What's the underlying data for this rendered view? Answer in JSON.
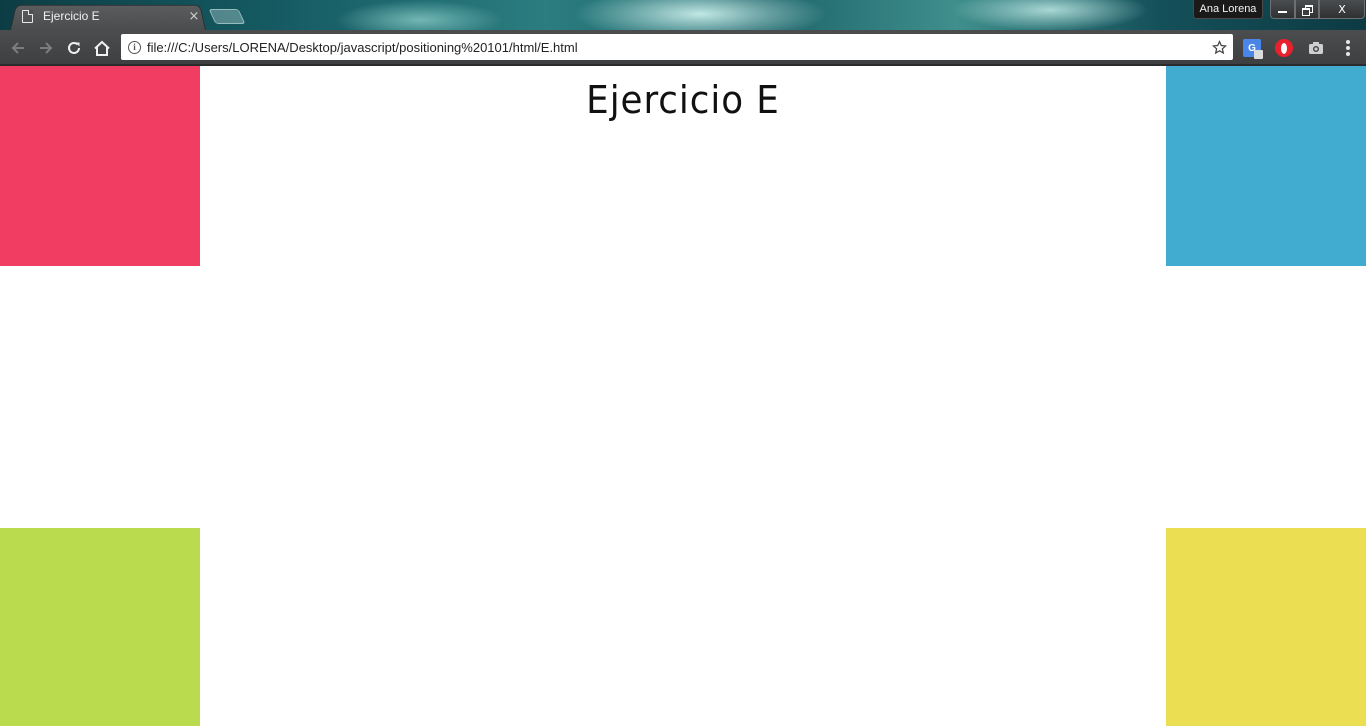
{
  "browser": {
    "tab": {
      "title": "Ejercicio E",
      "close_glyph": "×",
      "icon": "document-icon"
    },
    "profile_name": "Ana Lorena",
    "window_controls": {
      "close_glyph": "X"
    },
    "toolbar": {
      "url": "file:///C:/Users/LORENA/Desktop/javascript/positioning%20101/html/E.html",
      "icons": [
        "back-arrow-icon",
        "forward-arrow-icon",
        "reload-icon",
        "home-icon",
        "info-icon",
        "bookmark-star-icon",
        "google-translate-icon",
        "opera-icon",
        "camera-icon",
        "menu-dots-icon"
      ]
    }
  },
  "page": {
    "title": "Ejercicio E",
    "boxes": {
      "top_left_color": "#f23d63",
      "top_right_color": "#42abd0",
      "bottom_left_color": "#badb4e",
      "bottom_right_color": "#ebde53"
    }
  }
}
